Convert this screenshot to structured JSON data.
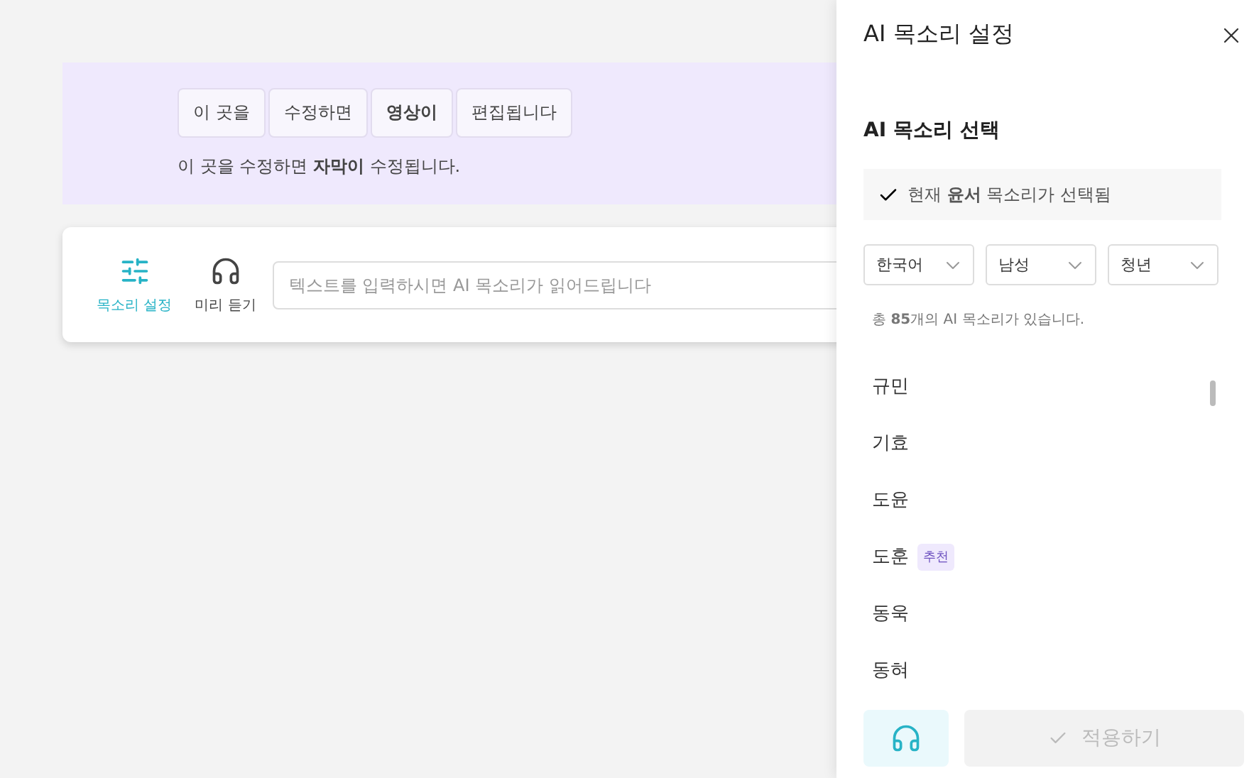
{
  "editor": {
    "chips": [
      {
        "text": "이 곳을",
        "emphasized": false
      },
      {
        "text": "수정하면",
        "emphasized": false
      },
      {
        "text": "영상이",
        "emphasized": true
      },
      {
        "text": "편집됩니다",
        "emphasized": false
      }
    ],
    "caption": "이 곳을 수정하면 **자막이** 수정됩니다."
  },
  "toolbar": {
    "tools": [
      {
        "label": "목소리 설정",
        "kind": "sliders",
        "selected": true
      },
      {
        "label": "미리 듣기",
        "kind": "headphones",
        "selected": false
      }
    ],
    "input": {
      "placeholder": "텍스트를 입력하시면 AI 목소리가 읽어드립니다"
    }
  },
  "panel": {
    "title": "AI 목소리 설정",
    "section_title": "AI 목소리 선택",
    "current": "현재 **윤서** 목소리가 선택됨",
    "filters": [
      "한국어",
      "남성",
      "청년"
    ],
    "count": "총 **85**개의 AI 목소리가 있습니다.",
    "voices": [
      {
        "name": "규민"
      },
      {
        "name": "기효"
      },
      {
        "name": "도윤"
      },
      {
        "name": "도훈",
        "badge": "추천"
      },
      {
        "name": "동욱"
      },
      {
        "name": "동혀"
      }
    ],
    "apply_button": {
      "label": "적용하기",
      "disabled": true
    }
  }
}
